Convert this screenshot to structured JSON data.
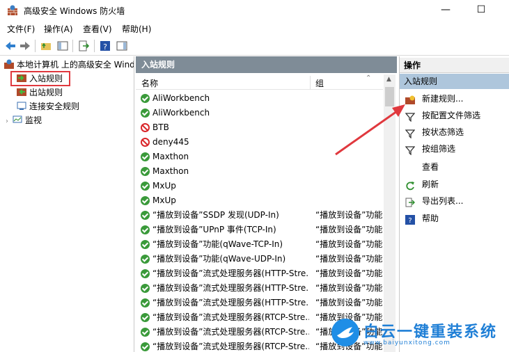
{
  "window": {
    "title": "高级安全 Windows 防火墙",
    "minimize": "—",
    "maximize": "☐"
  },
  "menu": [
    "文件(F)",
    "操作(A)",
    "查看(V)",
    "帮助(H)"
  ],
  "tree": {
    "root": "本地计算机 上的高级安全 Windows 防火墙",
    "items": [
      "入站规则",
      "出站规则",
      "连接安全规则",
      "监视"
    ]
  },
  "center": {
    "header": "入站规则",
    "columns": [
      "名称",
      "组"
    ],
    "rows": [
      {
        "name": "AliWorkbench",
        "group": "",
        "status": "ok"
      },
      {
        "name": "AliWorkbench",
        "group": "",
        "status": "ok"
      },
      {
        "name": "BTB",
        "group": "",
        "status": "blocked"
      },
      {
        "name": "deny445",
        "group": "",
        "status": "blocked"
      },
      {
        "name": "Maxthon",
        "group": "",
        "status": "ok"
      },
      {
        "name": "Maxthon",
        "group": "",
        "status": "ok"
      },
      {
        "name": "MxUp",
        "group": "",
        "status": "ok"
      },
      {
        "name": "MxUp",
        "group": "",
        "status": "ok"
      },
      {
        "name": "“播放到设备”SSDP 发现(UDP-In)",
        "group": "“播放到设备”功能",
        "status": "ok"
      },
      {
        "name": "“播放到设备”UPnP 事件(TCP-In)",
        "group": "“播放到设备”功能",
        "status": "ok"
      },
      {
        "name": "“播放到设备”功能(qWave-TCP-In)",
        "group": "“播放到设备”功能",
        "status": "ok"
      },
      {
        "name": "“播放到设备”功能(qWave-UDP-In)",
        "group": "“播放到设备”功能",
        "status": "ok"
      },
      {
        "name": "“播放到设备”流式处理服务器(HTTP-Stre...",
        "group": "“播放到设备”功能",
        "status": "ok"
      },
      {
        "name": "“播放到设备”流式处理服务器(HTTP-Stre...",
        "group": "“播放到设备”功能",
        "status": "ok"
      },
      {
        "name": "“播放到设备”流式处理服务器(HTTP-Stre...",
        "group": "“播放到设备”功能",
        "status": "ok"
      },
      {
        "name": "“播放到设备”流式处理服务器(RTCP-Stre...",
        "group": "“播放到设备”功能",
        "status": "ok"
      },
      {
        "name": "“播放到设备”流式处理服务器(RTCP-Stre...",
        "group": "“播放到设备”功能",
        "status": "ok"
      },
      {
        "name": "“播放到设备”流式处理服务器(RTCP-Stre...",
        "group": "“播放到设备”功能",
        "status": "ok"
      }
    ]
  },
  "actions": {
    "header": "操作",
    "section": "入站规则",
    "items": [
      {
        "label": "新建规则...",
        "icon": "new-rule-icon"
      },
      {
        "label": "按配置文件筛选",
        "icon": "filter-icon"
      },
      {
        "label": "按状态筛选",
        "icon": "filter-icon"
      },
      {
        "label": "按组筛选",
        "icon": "filter-icon"
      },
      {
        "label": "查看",
        "icon": ""
      },
      {
        "label": "刷新",
        "icon": "refresh-icon"
      },
      {
        "label": "导出列表...",
        "icon": "export-icon"
      },
      {
        "label": "帮助",
        "icon": "help-icon"
      }
    ]
  },
  "watermark": {
    "brand": "白云一键重装系统",
    "url": "www.baiyunxitong.com"
  },
  "colors": {
    "highlight_box": "#e0383e",
    "pane_header": "#7f8c97",
    "selected_action": "#aec6dc",
    "annotation_arrow": "#e0383e"
  }
}
